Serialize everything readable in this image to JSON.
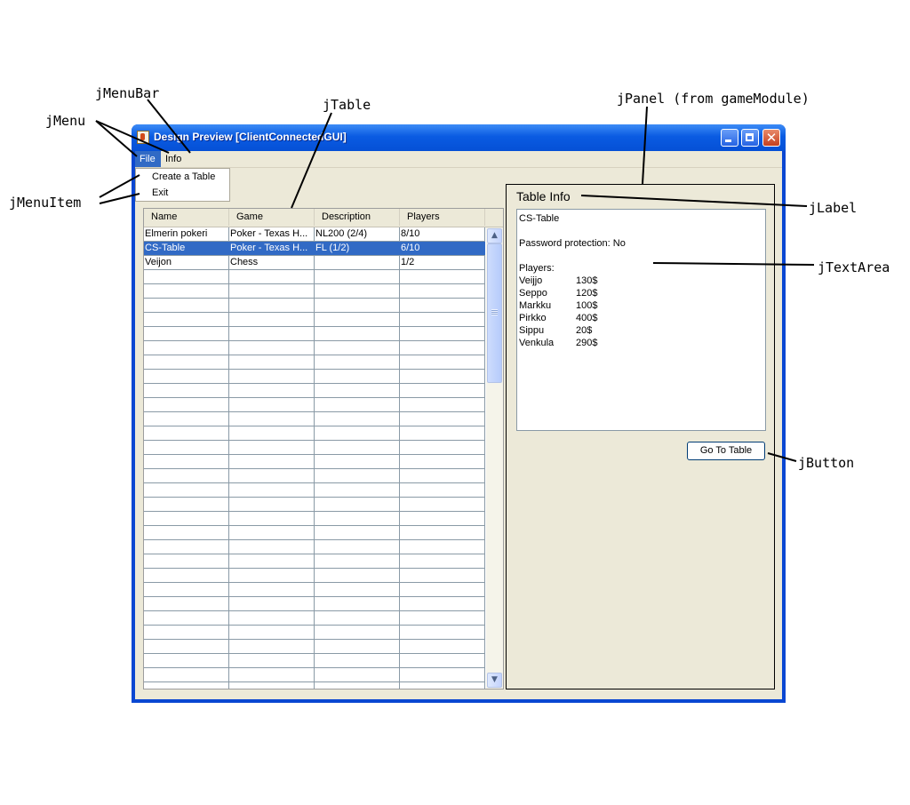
{
  "annotations": {
    "menubar": "jMenuBar",
    "menu": "jMenu",
    "menuitem": "jMenuItem",
    "table": "jTable",
    "panel": "jPanel (from gameModule)",
    "label": "jLabel",
    "textarea": "jTextArea",
    "button": "jButton"
  },
  "window": {
    "title": "Design Preview [ClientConnectedGUI]",
    "close_glyph": "✕"
  },
  "menubar": {
    "file": "File",
    "info": "Info"
  },
  "file_menu": {
    "items": [
      "Create a Table",
      "Exit"
    ]
  },
  "table": {
    "columns": [
      "Name",
      "Game",
      "Description",
      "Players"
    ],
    "rows": [
      [
        "Elmerin pokeri",
        "Poker - Texas H...",
        "NL200 (2/4)",
        "8/10"
      ],
      [
        "CS-Table",
        "Poker - Texas H...",
        "FL (1/2)",
        "6/10"
      ],
      [
        "Veijon",
        "Chess",
        "",
        "1/2"
      ]
    ],
    "selected_row": 1,
    "scroll_up_glyph": "▲",
    "scroll_down_glyph": "▼"
  },
  "panel": {
    "label": "Table Info",
    "info_title": "CS-Table",
    "password_line": "Password protection: No",
    "players_heading": "Players:",
    "players": [
      {
        "name": "Veijjo",
        "amount": "130$"
      },
      {
        "name": "Seppo",
        "amount": "120$"
      },
      {
        "name": "Markku",
        "amount": "100$"
      },
      {
        "name": "Pirkko",
        "amount": "400$"
      },
      {
        "name": "Sippu",
        "amount": "20$"
      },
      {
        "name": "Venkula",
        "amount": "290$"
      }
    ],
    "button": "Go To Table"
  },
  "colors": {
    "selection": "#316ac5",
    "window_frame": "#0a47d2",
    "client_background": "#ece9d8"
  }
}
